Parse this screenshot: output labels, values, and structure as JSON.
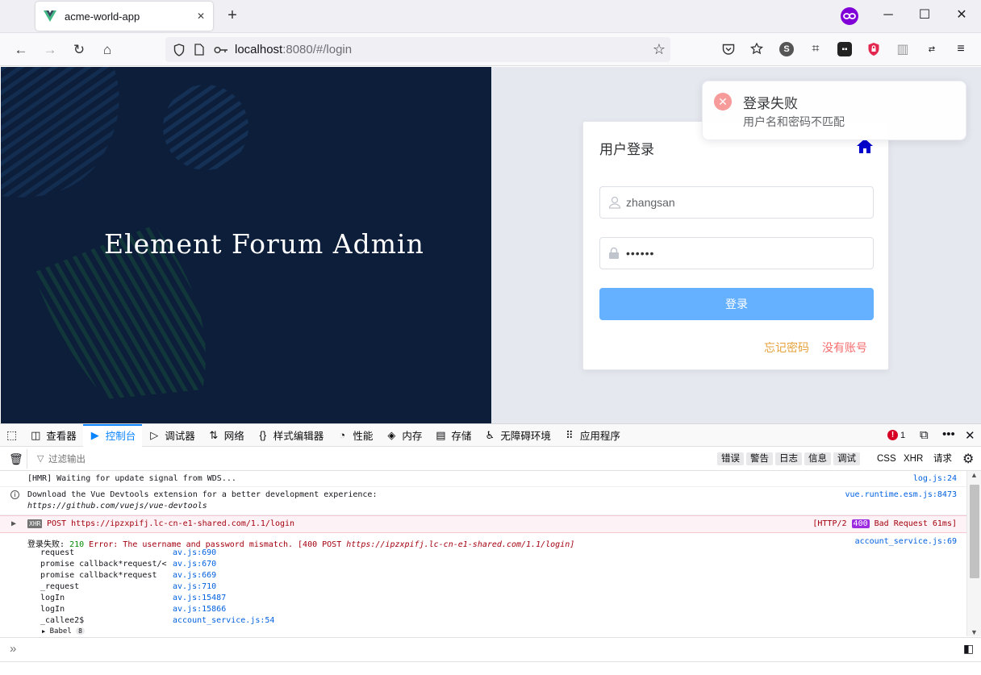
{
  "browser": {
    "tab_title": "acme-world-app",
    "new_tab": "+",
    "url_host": "localhost",
    "url_path": ":8080/#/login",
    "window_min": "─",
    "window_max": "☐",
    "window_close": "✕"
  },
  "app": {
    "brand": "Element Forum Admin",
    "card_title": "用户登录",
    "username_value": "zhangsan",
    "password_mask": "••••••",
    "login_button": "登录",
    "forgot_link": "忘记密码",
    "register_link": "没有账号"
  },
  "toast": {
    "title": "登录失败",
    "message": "用户名和密码不匹配"
  },
  "devtools": {
    "tabs": [
      {
        "label": "查看器",
        "icon": "◫"
      },
      {
        "label": "控制台",
        "icon": "▶"
      },
      {
        "label": "调试器",
        "icon": "▷"
      },
      {
        "label": "网络",
        "icon": "⇅"
      },
      {
        "label": "样式编辑器",
        "icon": "{}"
      },
      {
        "label": "性能",
        "icon": "◔"
      },
      {
        "label": "内存",
        "icon": "◈"
      },
      {
        "label": "存储",
        "icon": "▤"
      },
      {
        "label": "无障碍环境",
        "icon": "♿"
      },
      {
        "label": "应用程序",
        "icon": "⠿"
      }
    ],
    "error_count": "1",
    "filter_placeholder": "过滤输出",
    "filters": [
      "错误",
      "警告",
      "日志",
      "信息",
      "调试"
    ],
    "plain_filters": [
      "CSS",
      "XHR",
      "请求"
    ]
  },
  "console": {
    "hmr_text": "[HMR] Waiting for update signal from WDS...",
    "hmr_src": "log.js:24",
    "devtools_line1": "Download the Vue Devtools extension for a better development experience:",
    "devtools_line2": "https://github.com/vuejs/vue-devtools",
    "devtools_src": "vue.runtime.esm.js:8473",
    "xhr_badge": "XHR",
    "xhr_text": "POST https://ipzxpifj.lc-cn-e1-shared.com/1.1/login",
    "xhr_status_pre": "[HTTP/2",
    "xhr_status_code": "400",
    "xhr_status_post": "Bad Request 61ms]",
    "err_prefix": "登录失败:",
    "err_code": "210",
    "err_text": "Error: The username and password mismatch. [400 POST",
    "err_url": "https://ipzxpifj.lc-cn-e1-shared.com/1.1/login]",
    "err_src": "account_service.js:69",
    "stack": [
      {
        "fn": "request",
        "loc": "av.js:690"
      },
      {
        "fn": "promise callback*request/<",
        "loc": "av.js:670"
      },
      {
        "fn": "promise callback*request",
        "loc": "av.js:669"
      },
      {
        "fn": "_request",
        "loc": "av.js:710"
      },
      {
        "fn": "logIn",
        "loc": "av.js:15487"
      },
      {
        "fn": "logIn",
        "loc": "av.js:15866"
      },
      {
        "fn": "_callee2$",
        "loc": "account_service.js:54"
      }
    ],
    "babel": "Babel",
    "babel_count": "8",
    "prompt": "»"
  }
}
